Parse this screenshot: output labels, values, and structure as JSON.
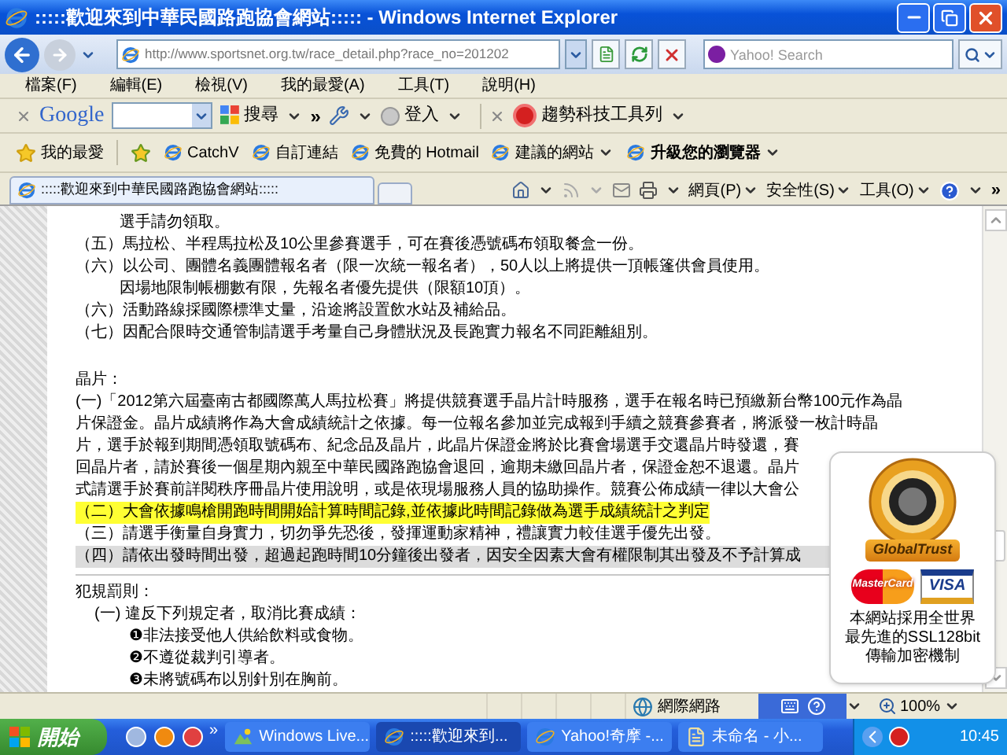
{
  "window": {
    "title": ":::::歡迎來到中華民國路跑協會網站::::: - Windows Internet Explorer"
  },
  "address_bar": {
    "url": "http://www.sportsnet.org.tw/race_detail.php?race_no=201202"
  },
  "search": {
    "placeholder": "Yahoo! Search"
  },
  "menu": [
    "檔案(F)",
    "編輯(E)",
    "檢視(V)",
    "我的最愛(A)",
    "工具(T)",
    "說明(H)"
  ],
  "google_toolbar": {
    "brand": "Google",
    "search_label": "搜尋",
    "more": "»",
    "signin": "登入",
    "trend_toolbar": "趨勢科技工具列"
  },
  "favorites_bar": {
    "favorites": "我的最愛",
    "links": [
      {
        "label": "CatchV",
        "kind": "link"
      },
      {
        "label": "自訂連結",
        "kind": "link"
      },
      {
        "label": "免費的 Hotmail",
        "kind": "link"
      },
      {
        "label": "建議的網站",
        "kind": "menu"
      },
      {
        "label": "升級您的瀏覽器",
        "kind": "strong"
      }
    ]
  },
  "tabs": [
    {
      "label": ":::::歡迎來到中華民國路跑協會網站:::::",
      "selected": true
    }
  ],
  "command_bar": {
    "menus": [
      "網頁(P)",
      "安全性(S)",
      "工具(O)"
    ],
    "more": "»"
  },
  "content": [
    {
      "kind": "cont",
      "text": "選手請勿領取。"
    },
    {
      "kind": "item",
      "text": "（五）馬拉松、半程馬拉松及10公里參賽選手，可在賽後憑號碼布領取餐盒一份。"
    },
    {
      "kind": "item",
      "text": "（六）以公司、團體名義團體報名者（限一次統一報名者），50人以上將提供一頂帳篷供會員使用。"
    },
    {
      "kind": "cont",
      "text": "因場地限制帳棚數有限，先報名者優先提供（限額10頂）。"
    },
    {
      "kind": "item",
      "text": "（六）活動路線採國際標準丈量，沿途將設置飲水站及補給品。"
    },
    {
      "kind": "item",
      "text": "（七）因配合限時交通管制請選手考量自己身體狀況及長跑實力報名不同距離組別。"
    },
    {
      "kind": "heading",
      "text": "晶片："
    },
    {
      "kind": "para",
      "text": "(一)「2012第六屆臺南古都國際萬人馬拉松賽」將提供競賽選手晶片計時服務，選手在報名時已預繳新台幣100元作為晶"
    },
    {
      "kind": "para",
      "text": "片保證金。晶片成績將作為大會成績統計之依據。每一位報名參加並完成報到手續之競賽參賽者，將派發一枚計時晶"
    },
    {
      "kind": "para",
      "text": "片，選手於報到期間憑領取號碼布、紀念品及晶片，此晶片保證金將於比賽會場選手交還晶片時發還，賽"
    },
    {
      "kind": "para",
      "text": "回晶片者，請於賽後一個星期內親至中華民國路跑協會退回，逾期未繳回晶片者，保證金恕不退還。晶片"
    },
    {
      "kind": "para",
      "text": "式請選手於賽前詳閱秩序冊晶片使用說明，或是依現場服務人員的協助操作。競賽公佈成績一律以大會公"
    },
    {
      "kind": "highlighted",
      "text": "（二）大會依據鳴槍開跑時間開始計算時間記錄,並依據此時間記錄做為選手成績統計之判定"
    },
    {
      "kind": "item",
      "text": "（三）請選手衡量自身實力，切勿爭先恐後，發揮運動家精神，禮讓實力較佳選手優先出發。"
    },
    {
      "kind": "shaded",
      "text": "（四）請依出發時間出發，超過起跑時間10分鐘後出發者，因安全因素大會有權限制其出發及不予計算成"
    },
    {
      "kind": "divided",
      "text": "犯規罰則："
    },
    {
      "kind": "subitem",
      "text": "(一) 違反下列規定者，取消比賽成績："
    },
    {
      "kind": "bullet",
      "text": "❶非法接受他人供給飲料或食物。"
    },
    {
      "kind": "bullet",
      "text": "❷不遵從裁判引導者。"
    },
    {
      "kind": "bullet",
      "text": "❸未將號碼布以別針別在胸前。"
    }
  ],
  "seal_popup": {
    "brand": "GlobalTrust",
    "cards": [
      {
        "label": "MasterCard",
        "kind": "mastercard"
      },
      {
        "label": "VISA",
        "kind": "visa"
      }
    ],
    "lines": [
      "本網站採用全世界",
      "最先進的SSL128bit",
      "傳輸加密機制"
    ]
  },
  "status_bar": {
    "zone": "網際網路",
    "zoom": "100%"
  },
  "taskbar": {
    "start": "開始",
    "more": "»",
    "tasks": [
      {
        "label": "Windows Live...",
        "kind": "photo",
        "selected": false
      },
      {
        "label": ":::::歡迎來到...",
        "kind": "browser",
        "selected": true
      },
      {
        "label": "Yahoo!奇摩 -...",
        "kind": "browser",
        "selected": false
      },
      {
        "label": "未命名 - 小...",
        "kind": "notepad",
        "selected": false
      }
    ],
    "clock": "10:45"
  }
}
